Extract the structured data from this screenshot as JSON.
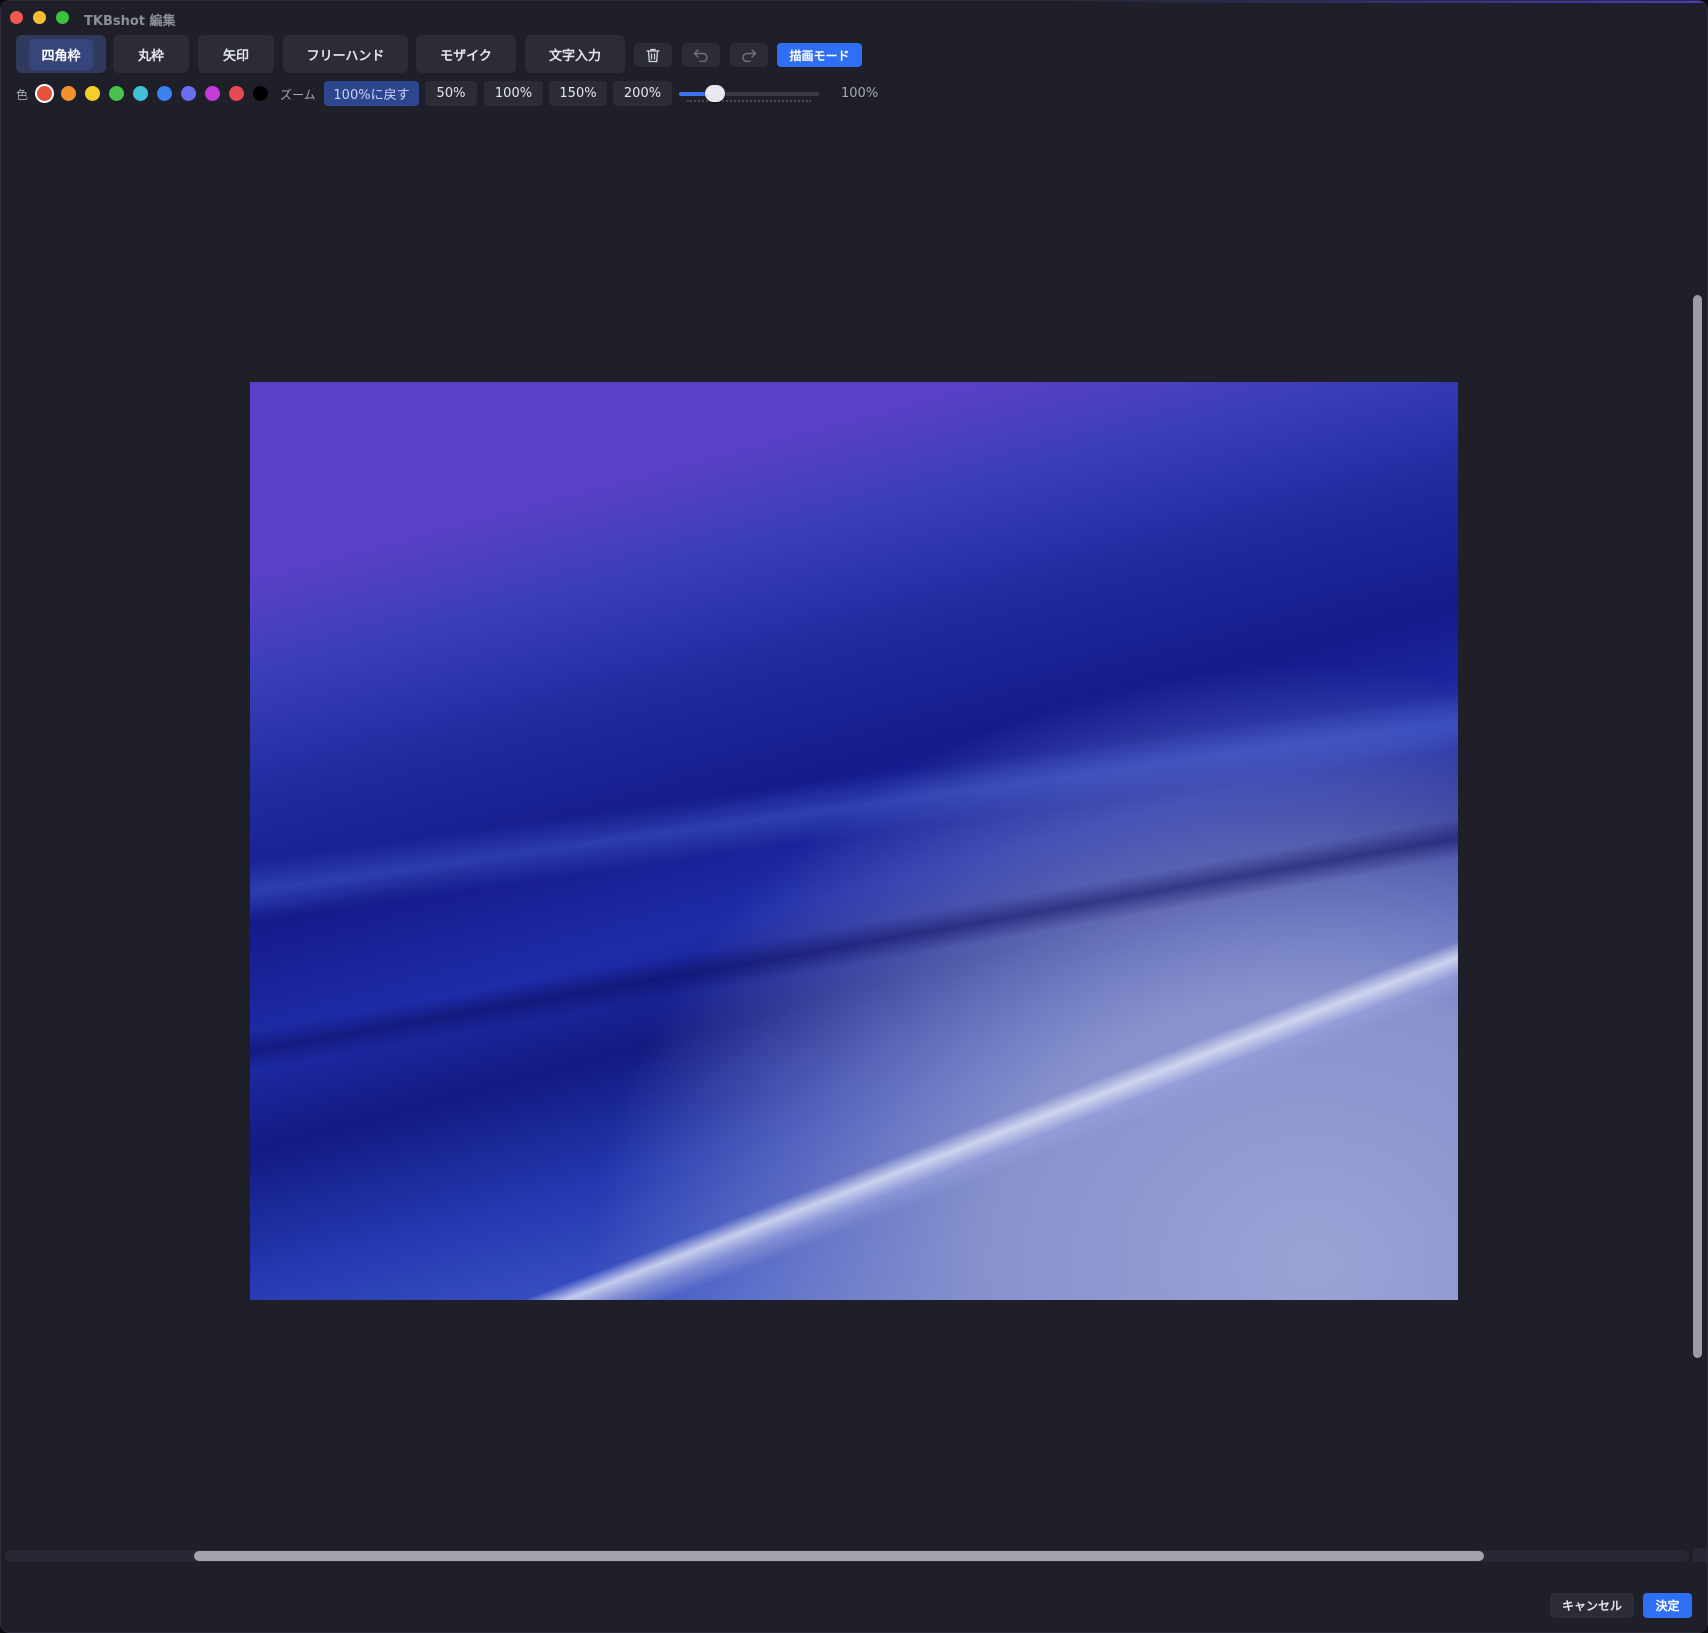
{
  "window": {
    "title": "TKBshot 編集"
  },
  "toolbar": {
    "tools": [
      {
        "label": "四角枠",
        "active": true
      },
      {
        "label": "丸枠",
        "active": false
      },
      {
        "label": "矢印",
        "active": false
      },
      {
        "label": "フリーハンド",
        "active": false
      },
      {
        "label": "モザイク",
        "active": false
      },
      {
        "label": "文字入力",
        "active": false
      }
    ],
    "icons": [
      "trash-icon",
      "undo-icon",
      "redo-icon"
    ],
    "draw_mode_label": "描画モード"
  },
  "colors": {
    "label": "色",
    "swatches": [
      "#e5533d",
      "#f0902f",
      "#f3cf2c",
      "#49c24c",
      "#3fc1d8",
      "#3b82f0",
      "#6c6cf0",
      "#c43bd8",
      "#e84a55",
      "#000000"
    ],
    "selected_index": 0
  },
  "zoom": {
    "label": "ズーム",
    "reset_label": "100%に戻す",
    "presets": [
      "50%",
      "100%",
      "150%",
      "200%"
    ],
    "slider_fraction": 0.2,
    "value_text": "100%"
  },
  "footer": {
    "cancel_label": "キャンセル",
    "confirm_label": "決定"
  },
  "accent_color": "#2f6ff5"
}
